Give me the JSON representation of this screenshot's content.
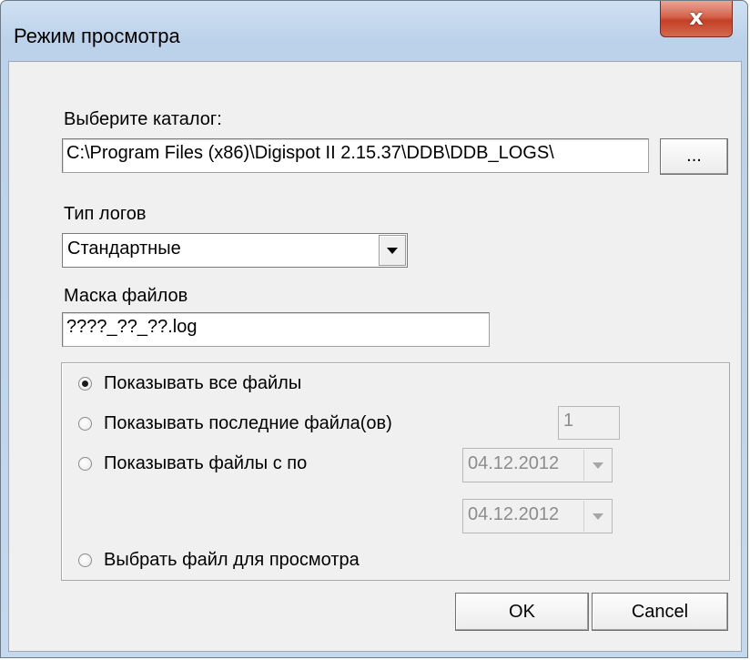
{
  "window": {
    "title": "Режим просмотра",
    "close_symbol": "x"
  },
  "folder": {
    "label": "Выберите каталог:",
    "path": "C:\\Program Files (x86)\\Digispot II 2.15.37\\DDB\\DDB_LOGS\\",
    "browse_label": "..."
  },
  "log_type": {
    "label": "Тип логов",
    "selected": "Стандартные"
  },
  "file_mask": {
    "label": "Маска файлов",
    "value": "????_??_??.log"
  },
  "options": {
    "show_all": {
      "label": "Показывать все файлы",
      "checked": true
    },
    "show_last": {
      "label": "Показывать последние файла(ов)",
      "count": "1"
    },
    "show_range": {
      "label": "Показывать файлы с по",
      "from": "04.12.2012",
      "to": "04.12.2012"
    },
    "choose_file": {
      "label": "Выбрать файл для просмотра"
    }
  },
  "buttons": {
    "ok": "OK",
    "cancel": "Cancel"
  },
  "colors": {
    "title_bar": "#c4d8ee",
    "client_bg": "#f0f0f0",
    "close_button": "#c33f25"
  }
}
